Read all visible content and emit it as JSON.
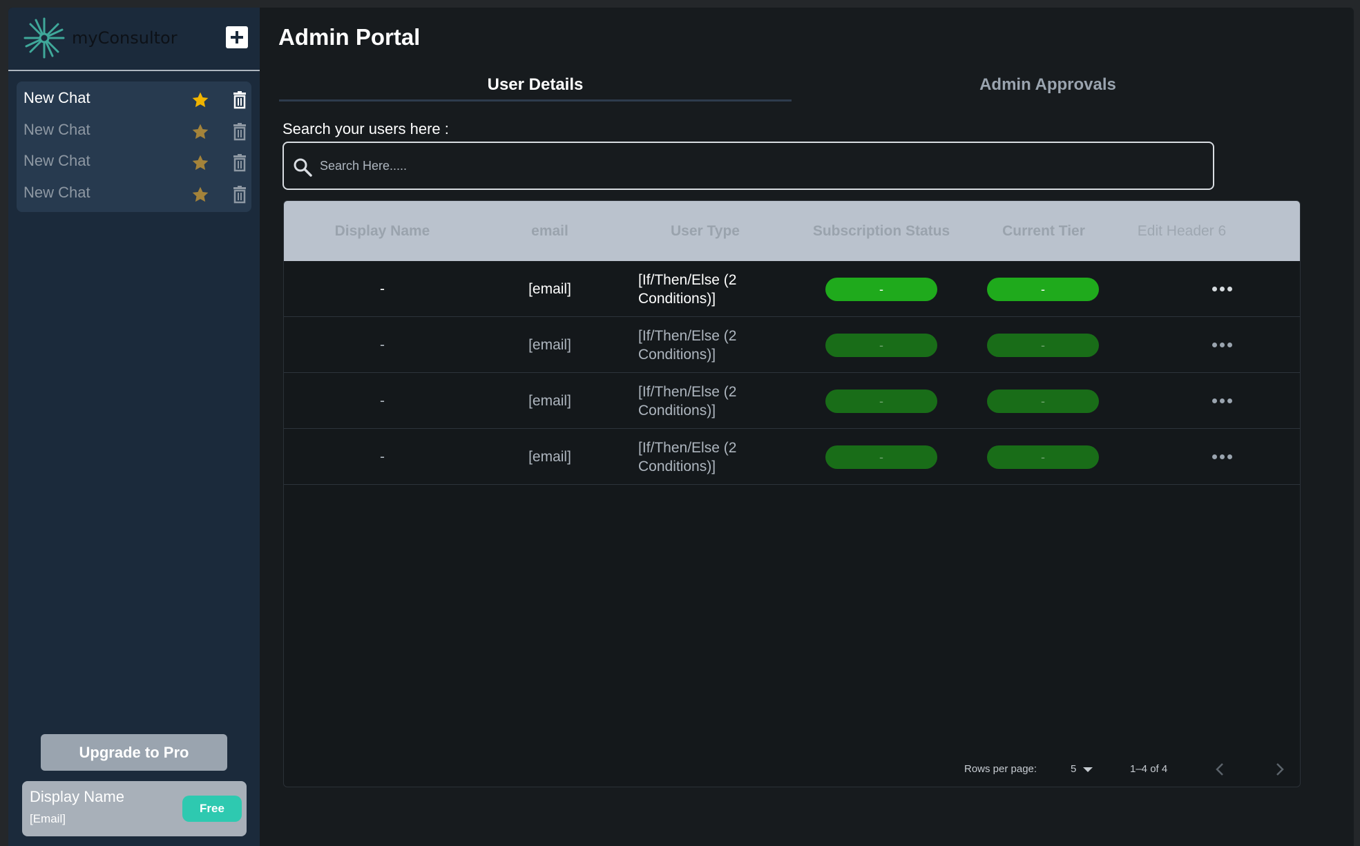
{
  "app": {
    "brand": "myConsultor"
  },
  "sidebar": {
    "chats": [
      {
        "label": "New Chat",
        "active": true
      },
      {
        "label": "New Chat",
        "active": false
      },
      {
        "label": "New Chat",
        "active": false
      },
      {
        "label": "New Chat",
        "active": false
      }
    ],
    "upgrade_label": "Upgrade to Pro",
    "user": {
      "name": "Display Name",
      "email": "[Email]",
      "plan": "Free"
    }
  },
  "main": {
    "title": "Admin Portal",
    "tabs": [
      {
        "label": "User Details",
        "selected": true
      },
      {
        "label": "Admin Approvals",
        "selected": false
      }
    ],
    "search": {
      "label": "Search your users here :",
      "placeholder": "Search Here....."
    },
    "table": {
      "columns": [
        "Display Name",
        "email",
        "User Type",
        "Subscription Status",
        "Current Tier",
        "Edit Header 6"
      ],
      "rows": [
        {
          "display_name": "-",
          "email": "[email]",
          "user_type": "[If/Then/Else (2 Conditions)]",
          "subscription_status": "-",
          "current_tier": "-"
        },
        {
          "display_name": "-",
          "email": "[email]",
          "user_type": "[If/Then/Else (2 Conditions)]",
          "subscription_status": "-",
          "current_tier": "-"
        },
        {
          "display_name": "-",
          "email": "[email]",
          "user_type": "[If/Then/Else (2 Conditions)]",
          "subscription_status": "-",
          "current_tier": "-"
        },
        {
          "display_name": "-",
          "email": "[email]",
          "user_type": "[If/Then/Else (2 Conditions)]",
          "subscription_status": "-",
          "current_tier": "-"
        }
      ]
    },
    "pagination": {
      "rows_per_page_label": "Rows per page:",
      "rows_per_page": "5",
      "range": "1–4 of 4"
    }
  },
  "colors": {
    "accent_green": "#1faa1c",
    "star": "#f0b400",
    "badge_teal": "#2ec9b0"
  }
}
